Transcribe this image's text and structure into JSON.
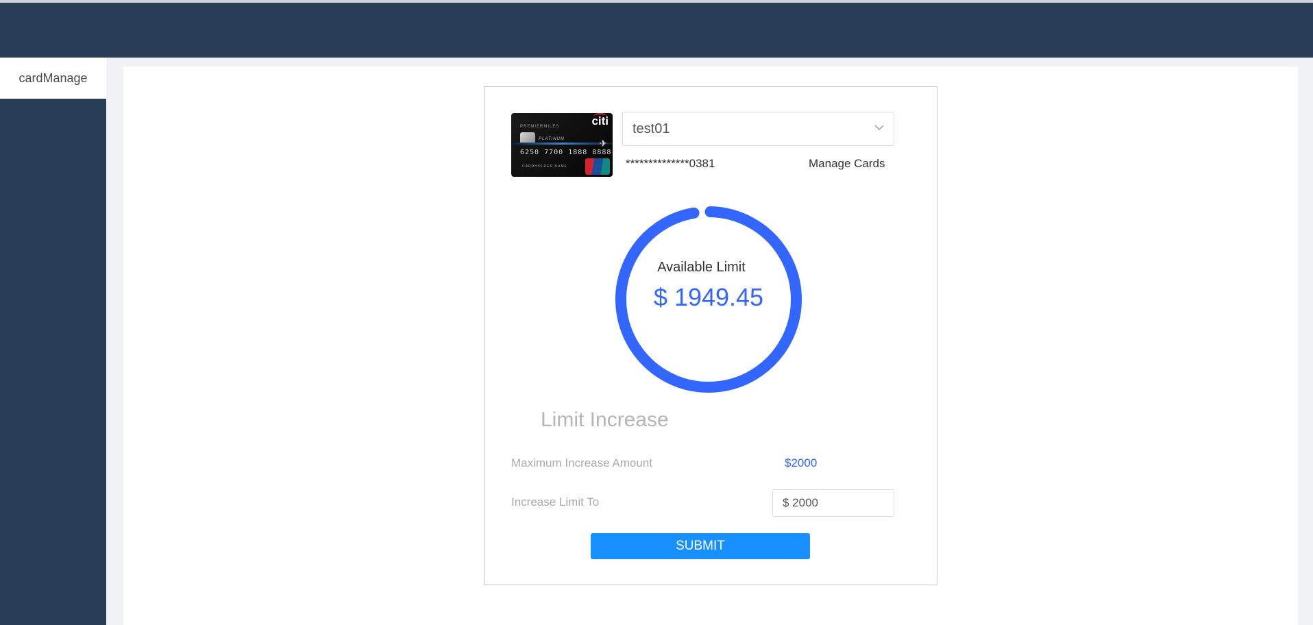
{
  "sidebar": {
    "items": [
      {
        "label": "cardManage"
      }
    ]
  },
  "card": {
    "image": {
      "brand": "citi",
      "tag": "PREMIERMILES",
      "tier": "PLATINUM",
      "number": "6250 7700 1888 8888",
      "holder": "CARDHOLDER NAME"
    },
    "selected": "test01",
    "masked_number": "**************0381",
    "manage_label": "Manage Cards"
  },
  "gauge": {
    "title": "Available Limit",
    "value": "$ 1949.45",
    "fraction": 0.97,
    "color": "#3366ff"
  },
  "limit": {
    "section_title": "Limit Increase",
    "max_label": "Maximum Increase Amount",
    "max_value": "$2000",
    "increase_label": "Increase Limit To",
    "increase_value": "$ 2000",
    "submit_label": "SUBMIT"
  },
  "colors": {
    "header": "#2a3d56",
    "accent": "#1890ff"
  }
}
